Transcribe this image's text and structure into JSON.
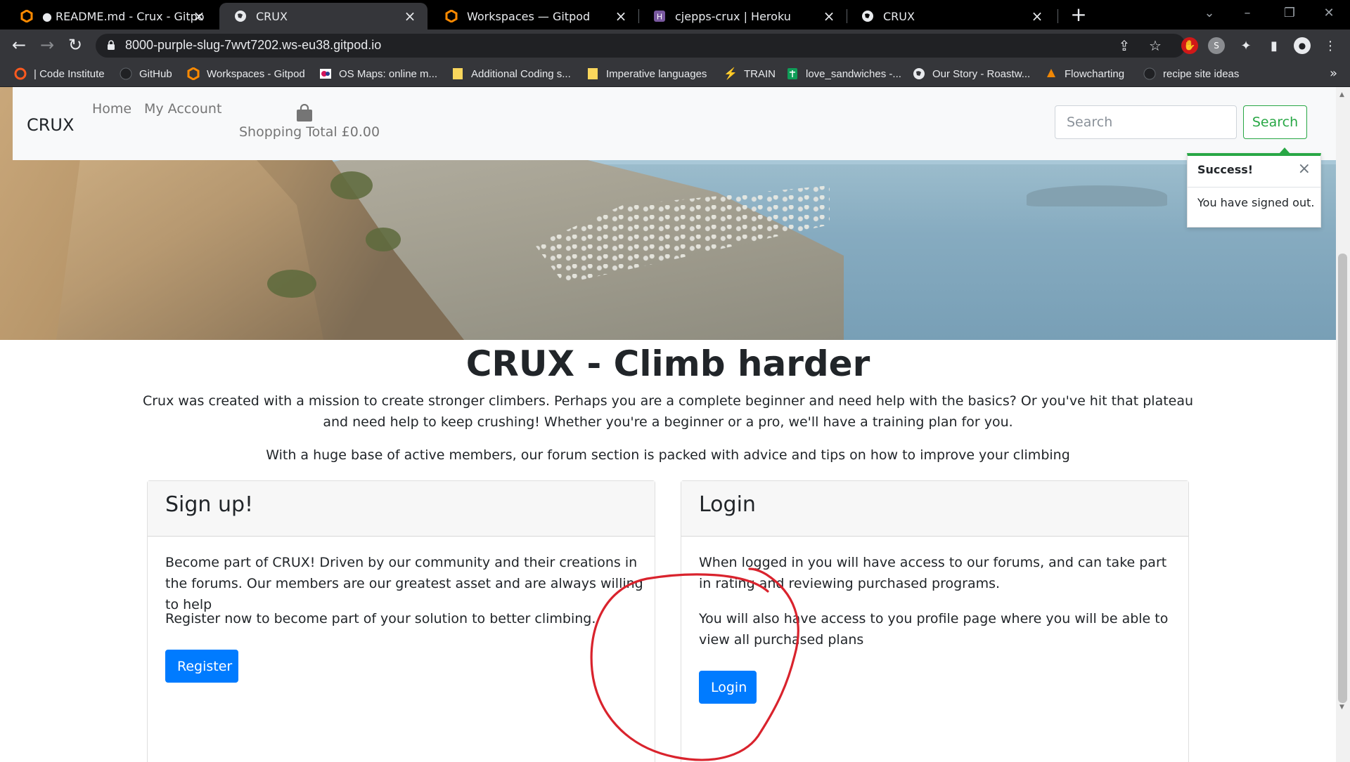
{
  "browser": {
    "tabs": [
      {
        "title": "● README.md - Crux - Gitpod Co",
        "icon": "gitpod-icon",
        "active": false
      },
      {
        "title": "CRUX",
        "icon": "globe-icon",
        "active": true
      },
      {
        "title": "Workspaces — Gitpod",
        "icon": "gitpod-icon",
        "active": false
      },
      {
        "title": "cjepps-crux | Heroku",
        "icon": "heroku-icon",
        "active": false
      },
      {
        "title": "CRUX",
        "icon": "globe-icon",
        "active": false
      }
    ],
    "url": "8000-purple-slug-7wvt7202.ws-eu38.gitpod.io",
    "bookmarks": [
      {
        "label": "| Code Institute",
        "icon": "code-institute-icon"
      },
      {
        "label": "GitHub",
        "icon": "github-icon"
      },
      {
        "label": "Workspaces - Gitpod",
        "icon": "gitpod-icon"
      },
      {
        "label": "OS Maps: online m...",
        "icon": "os-maps-icon"
      },
      {
        "label": "Additional Coding s...",
        "icon": "folder-icon"
      },
      {
        "label": "Imperative languages",
        "icon": "folder-icon"
      },
      {
        "label": "TRAIN",
        "icon": "train-icon"
      },
      {
        "label": "love_sandwiches -...",
        "icon": "sheets-icon"
      },
      {
        "label": "Our Story - Roastw...",
        "icon": "globe-icon"
      },
      {
        "label": "Flowcharting",
        "icon": "flowchart-icon"
      },
      {
        "label": "recipe site ideas",
        "icon": "github-icon"
      }
    ],
    "bookmarks_more": "»"
  },
  "navbar": {
    "brand": "CRUX",
    "links": [
      "Home",
      "My Account"
    ],
    "cart_total": "Shopping Total £0.00",
    "search_placeholder": "Search",
    "search_button": "Search"
  },
  "toast": {
    "title": "Success!",
    "message": "You have signed out.",
    "close": "×",
    "accent": "#28a745"
  },
  "main": {
    "heading": "CRUX - Climb harder",
    "intro": "Crux was created with a mission to create stronger climbers. Perhaps you are a complete beginner and need help with the basics? Or you've hit that plateau and need help to keep crushing! Whether you're a beginner or a pro, we'll have a training plan for you.",
    "intro2": "With a huge base of active members, our forum section is packed with advice and tips on how to improve your climbing"
  },
  "cards": {
    "signup": {
      "title": "Sign up!",
      "p1": "Become part of CRUX! Driven by our community and their creations in the forums. Our members are our greatest asset and are always willing to help",
      "p2": "Register now to become part of your solution to better climbing.",
      "button": "Register"
    },
    "login": {
      "title": "Login",
      "p1": "When logged in you will have access to our forums, and can take part in rating and reviewing purchased programs.",
      "p2": "You will also have access to you profile page where you will be able to view all purchased plans",
      "button": "Login"
    }
  },
  "colors": {
    "primary": "#007bff",
    "success": "#28a745",
    "annotation": "#d9232d"
  }
}
